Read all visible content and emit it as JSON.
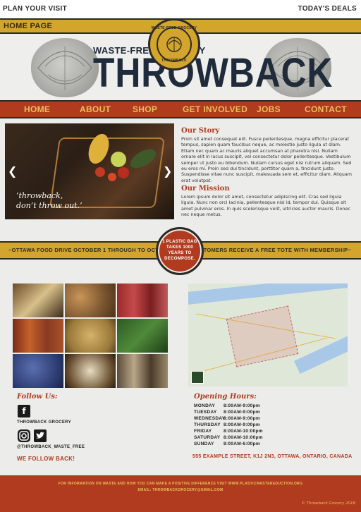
{
  "topbar": {
    "left": "PLAN YOUR VISIT",
    "right": "TODAY'S DEALS"
  },
  "goldbar": {
    "home": "HOME PAGE"
  },
  "header": {
    "tagline": "WASTE-FREE GROCERY",
    "brand": "THROWBACK"
  },
  "seal": {
    "top": "WASTE-FREE GROCERY",
    "bottom": "THROWBACK"
  },
  "nav": {
    "items": [
      "HOME",
      "ABOUT",
      "SHOP",
      "GET INVOLVED",
      "JOBS",
      "CONTACT"
    ]
  },
  "hero": {
    "quote_line1": "‘throwback,",
    "quote_line2": "don’t throw out.’",
    "prev": "❮",
    "next": "❯"
  },
  "story": {
    "title": "Our Story",
    "text": "Proin sit amet consequat elit. Fusce pellentesque, magna efficitur placerat tempus, sapien quam faucibus neque, ac molestie justo ligula ut diam. Etiam nec quam ac mauris aliquet accumsan at pharetra nisi. Nullam ornare elit in lacus suscipit, vel consectetur dolor pellentesque. Vestibulum semper ut justo eu bibendum. Nullam cursus eget nisi rutrum aliquam. Sed eu eros mi. Proin sed dui tincidunt, porttitor quam a, tincidunt justo. Suspendisse vitae nunc suscipit, malesuada sem et, efficitur diam. Aliquam erat volutpat."
  },
  "mission": {
    "title": "Our Mission",
    "text": "Lorem ipsum dolor sit amet, consectetur adipiscing elit. Cras sed ligula ligula. Nunc non orci lacinia, pellentesque nisi id, tempor dui. Quisque sit amet pulvinar eros. In quis scelerisque velit, ultricies auctor mauris. Donec nec neque metus."
  },
  "promo": {
    "left": "~OTTAWA FOOD DRIVE OCTOBER 1 THROUGH TO OCTOBER 31~",
    "right": "~ALL NEW CUSTOMERS RECEIVE A FREE TOTE WITH MEMBERSHIP~"
  },
  "badge": {
    "text": "1 PLASTIC BAG TAKES 1000 YEARS TO DECOMPOSE."
  },
  "follow": {
    "title": "Follow Us:",
    "facebook_handle": "THROWBACK GROCERY",
    "ig_tw_handle": "@THROWBACK_WASTE_FREE",
    "we_follow_back": "WE FOLLOW BACK!"
  },
  "hours": {
    "title": "Opening Hours:",
    "rows": [
      {
        "day": "MONDAY",
        "time": "8:00AM-9:00pm"
      },
      {
        "day": "TUESDAY",
        "time": "8:00AM-9:00pm"
      },
      {
        "day": "WEDNESDAY",
        "time": "8:00AM-9:00pm"
      },
      {
        "day": "THURSDAY",
        "time": "8:00AM-9:00pm"
      },
      {
        "day": "FRIDAY",
        "time": "8:00AM-10:00pm"
      },
      {
        "day": "SATURDAY",
        "time": "8:00AM-10:00pm"
      },
      {
        "day": "SUNDAY",
        "time": "8:00AM-6:00pm"
      }
    ],
    "address": "555 EXAMPLE STREET, K1J 2N3, OTTAWA, ONTARIO, CANADA"
  },
  "footer": {
    "line1": "FOR INFORMATION ON WASTE AND HOW YOU CAN MAKE A POSITIVE DIFFERENCE VISIT WWW.PLASTICWASTEREDUCTION.ORG",
    "line2": "EMAIL: THROWBACKGROCERY@GMAIL.COM",
    "copyright": "© Throwback Grocery 2018"
  },
  "colors": {
    "gold": "#d4a52c",
    "rust": "#b13b1e",
    "navy": "#1f2a3a"
  },
  "icons": [
    "facebook-icon",
    "instagram-icon",
    "twitter-icon",
    "carousel-prev-icon",
    "carousel-next-icon"
  ]
}
